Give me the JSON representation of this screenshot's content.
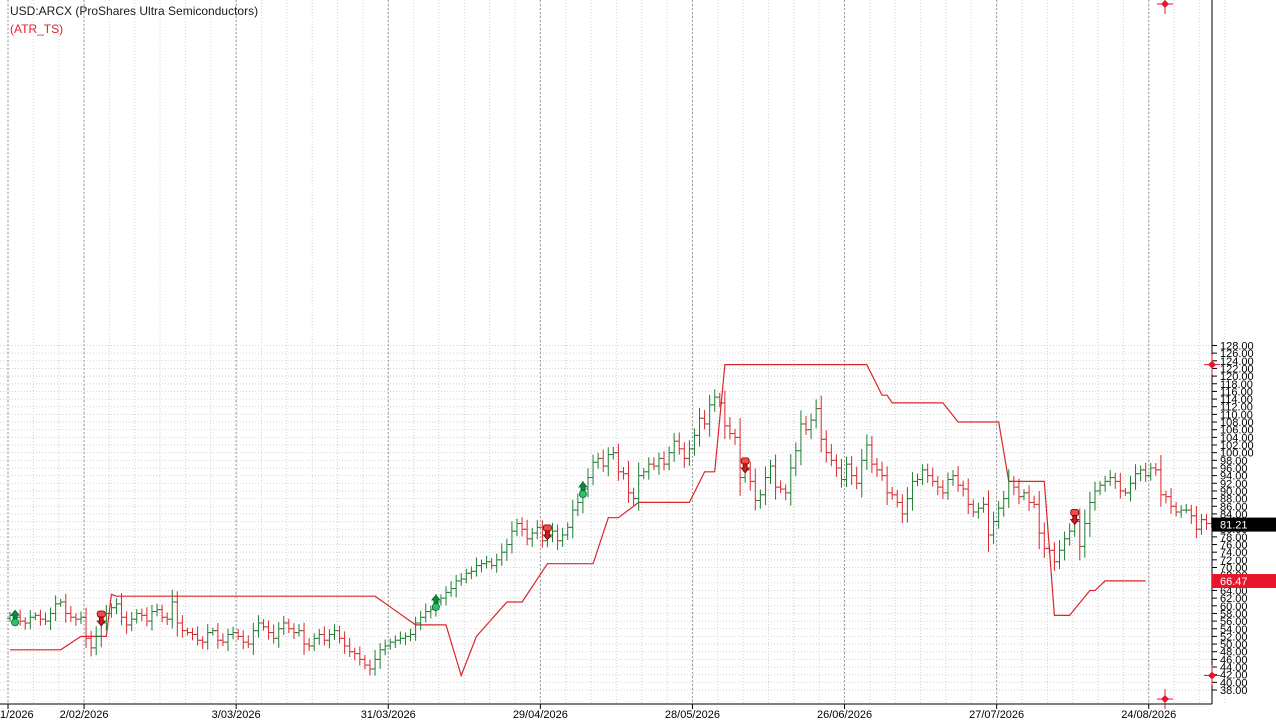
{
  "header": {
    "symbol_title": "USD:ARCX (ProShares Ultra Semiconductors)",
    "indicator_label": "(ATR_TS)"
  },
  "colors": {
    "up_bar": "#1e7d32",
    "down_bar": "#d9262a",
    "stop_line": "#d9262a",
    "grid": "#d2d2d2",
    "last_price_bg": "#000000",
    "stop_price_bg": "#e8162a"
  },
  "markers": {
    "last_price": "81.21",
    "stop_price": "66.47"
  },
  "chart_data": {
    "type": "ohlc",
    "y_axis": {
      "ylim": [
        37,
        128.5
      ],
      "ticks": [
        "38.00",
        "40.00",
        "42.00",
        "44.00",
        "46.00",
        "48.00",
        "50.00",
        "52.00",
        "54.00",
        "56.00",
        "58.00",
        "60.00",
        "62.00",
        "64.00",
        "66.00",
        "68.00",
        "70.00",
        "72.00",
        "74.00",
        "76.00",
        "78.00",
        "80.00",
        "82.00",
        "84.00",
        "86.00",
        "88.00",
        "90.00",
        "92.00",
        "94.00",
        "96.00",
        "98.00",
        "100.00",
        "102.00",
        "104.00",
        "106.00",
        "108.00",
        "110.00",
        "112.00",
        "114.00",
        "116.00",
        "118.00",
        "120.00",
        "122.00",
        "124.00",
        "126.00",
        "128.00"
      ]
    },
    "x_axis": {
      "ticks": [
        "1/2026",
        "2/02/2026",
        "3/03/2026",
        "31/03/2026",
        "29/04/2026",
        "28/05/2026",
        "26/06/2026",
        "27/07/2026",
        "24/08/2026"
      ],
      "tick_bar_index": [
        0,
        15,
        45,
        75,
        105,
        135,
        165,
        195,
        225
      ]
    },
    "bars_close": [
      57.5,
      57.0,
      56.0,
      55.5,
      57.0,
      57.5,
      56.5,
      56.0,
      58.0,
      60.5,
      61.0,
      58.0,
      57.0,
      56.5,
      57.0,
      51.5,
      49.0,
      52.0,
      55.5,
      58.0,
      59.5,
      60.5,
      57.0,
      55.0,
      56.5,
      58.0,
      57.5,
      56.0,
      58.5,
      59.0,
      57.0,
      56.5,
      61.0,
      55.5,
      53.5,
      53.0,
      52.5,
      51.0,
      50.5,
      53.0,
      53.5,
      51.0,
      50.5,
      52.5,
      53.0,
      52.0,
      50.5,
      50.0,
      53.5,
      55.5,
      54.5,
      53.0,
      51.5,
      54.0,
      55.5,
      54.0,
      53.0,
      53.5,
      50.0,
      49.5,
      51.5,
      52.5,
      51.0,
      52.5,
      53.5,
      51.5,
      49.5,
      48.0,
      47.5,
      46.0,
      44.5,
      43.5,
      46.0,
      48.5,
      49.5,
      50.5,
      51.0,
      51.5,
      52.0,
      52.5,
      55.5,
      57.0,
      58.5,
      59.0,
      61.0,
      62.0,
      63.5,
      64.5,
      66.5,
      67.0,
      68.5,
      69.0,
      70.5,
      71.0,
      71.5,
      70.5,
      72.0,
      74.0,
      76.0,
      79.5,
      81.5,
      80.0,
      77.5,
      79.0,
      80.5,
      77.0,
      78.0,
      79.5,
      77.0,
      78.5,
      80.5,
      85.0,
      87.0,
      90.5,
      93.5,
      97.5,
      98.5,
      96.5,
      99.5,
      100.0,
      95.0,
      94.5,
      89.5,
      88.0,
      94.0,
      95.0,
      97.0,
      96.5,
      98.5,
      97.0,
      100.0,
      103.0,
      101.0,
      98.5,
      101.0,
      104.5,
      109.0,
      107.5,
      112.5,
      114.5,
      113.0,
      107.0,
      105.0,
      104.0,
      93.5,
      95.5,
      92.5,
      87.5,
      89.0,
      93.5,
      96.5,
      91.0,
      90.5,
      89.5,
      96.0,
      100.5,
      107.5,
      106.0,
      108.5,
      111.5,
      103.5,
      100.0,
      98.0,
      96.0,
      93.0,
      97.0,
      94.0,
      92.0,
      98.0,
      102.0,
      97.0,
      95.5,
      94.0,
      89.5,
      89.0,
      87.0,
      84.0,
      88.0,
      92.5,
      93.0,
      95.5,
      94.0,
      92.5,
      91.0,
      89.5,
      93.0,
      94.0,
      91.5,
      90.5,
      86.5,
      84.5,
      85.5,
      86.5,
      78.5,
      82.0,
      85.5,
      88.0,
      92.5,
      91.0,
      88.5,
      89.5,
      87.0,
      86.5,
      79.0,
      75.0,
      74.5,
      71.5,
      74.5,
      77.5,
      79.5,
      82.0,
      75.5,
      81.5,
      87.0,
      90.0,
      91.5,
      92.5,
      93.5,
      92.5,
      90.0,
      89.5,
      92.0,
      94.5,
      95.5,
      94.0,
      96.0,
      95.5,
      89.0,
      88.5,
      86.0,
      84.5,
      85.0,
      85.0,
      83.5,
      80.0,
      82.5,
      81.5,
      81.2
    ],
    "stop_line": [
      {
        "i": 0,
        "v": 48.5
      },
      {
        "i": 10,
        "v": 48.5
      },
      {
        "i": 14,
        "v": 52.0
      },
      {
        "i": 19,
        "v": 52.0
      },
      {
        "i": 20,
        "v": 63.0
      },
      {
        "i": 21,
        "v": 62.5
      },
      {
        "i": 72,
        "v": 62.5
      },
      {
        "i": 80,
        "v": 55.0
      },
      {
        "i": 86,
        "v": 55.0
      },
      {
        "i": 89,
        "v": 41.8
      },
      {
        "i": 92,
        "v": 52.0
      },
      {
        "i": 98,
        "v": 61.0
      },
      {
        "i": 101,
        "v": 61.0
      },
      {
        "i": 106,
        "v": 71.0
      },
      {
        "i": 115,
        "v": 71.0
      },
      {
        "i": 118,
        "v": 83.0
      },
      {
        "i": 120,
        "v": 83.0
      },
      {
        "i": 124,
        "v": 87.0
      },
      {
        "i": 134,
        "v": 87.0
      },
      {
        "i": 137,
        "v": 95.0
      },
      {
        "i": 139,
        "v": 95.0
      },
      {
        "i": 141,
        "v": 123.0
      },
      {
        "i": 169,
        "v": 123.0
      },
      {
        "i": 172,
        "v": 115.0
      },
      {
        "i": 173,
        "v": 115.0
      },
      {
        "i": 174,
        "v": 113.0
      },
      {
        "i": 184,
        "v": 113.0
      },
      {
        "i": 187,
        "v": 108.0
      },
      {
        "i": 195,
        "v": 108.0
      },
      {
        "i": 197,
        "v": 92.5
      },
      {
        "i": 204,
        "v": 92.5
      },
      {
        "i": 206,
        "v": 57.5
      },
      {
        "i": 209,
        "v": 57.5
      },
      {
        "i": 213,
        "v": 64.0
      },
      {
        "i": 214,
        "v": 64.0
      },
      {
        "i": 216,
        "v": 66.5
      },
      {
        "i": 224,
        "v": 66.5
      }
    ],
    "buy_signals": [
      1,
      84,
      113
    ],
    "sell_signals": [
      18,
      106,
      145,
      210
    ]
  }
}
